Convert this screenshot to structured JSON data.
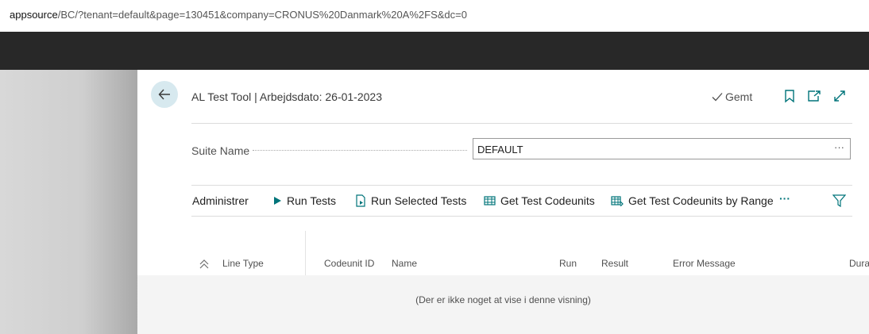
{
  "browser": {
    "url_host": "appsource",
    "url_path": "/BC/?tenant=default&page=130451&company=CRONUS%20Danmark%20A%2FS&dc=0"
  },
  "header": {
    "title": "AL Test Tool | Arbejdsdato: 26-01-2023",
    "saved_label": "Gemt",
    "icons": [
      "back-arrow-icon",
      "checkmark-icon",
      "bookmark-icon",
      "open-new-window-icon",
      "expand-icon"
    ]
  },
  "field": {
    "label": "Suite Name",
    "value": "DEFAULT",
    "more": "···"
  },
  "actions": {
    "manage": "Administrer",
    "run_tests": "Run Tests",
    "run_selected": "Run Selected Tests",
    "get_codeunits": "Get Test Codeunits",
    "get_codeunits_range": "Get Test Codeunits by Range",
    "more": "···"
  },
  "grid": {
    "columns": [
      "Line Type",
      "Codeunit ID",
      "Name",
      "Run",
      "Result",
      "Error Message",
      "Dura"
    ],
    "empty_message": "(Der er ikke noget at vise i denne visning)"
  },
  "colors": {
    "accent": "#00747a",
    "dark_band": "#282828",
    "back_button_bg": "#d7e9ef"
  }
}
